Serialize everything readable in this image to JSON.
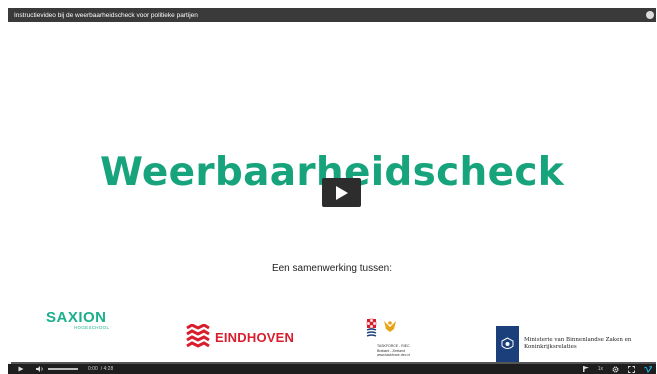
{
  "window": {
    "title": "Instructievideo bij de weerbaarheidscheck voor politieke partijen"
  },
  "slide": {
    "heading": "Weerbaarheidscheck",
    "subtitle": "Een samenwerking tussen:",
    "logos": {
      "saxion": {
        "main": "SAXION",
        "sub": "HOGESCHOOL"
      },
      "eindhoven": {
        "name": "EINDHOVEN"
      },
      "taskforce": {
        "line1": "TASKFORCE - RIEC",
        "line2": "Brabant - Zeeland",
        "line3": "www.taskforce-riec.nl"
      },
      "ministerie": {
        "name": "Ministerie van Binnenlandse Zaken en Koninkrijksrelaties"
      }
    }
  },
  "controls": {
    "current_time": "0:00",
    "duration": "/ 4:28",
    "speed": "1x",
    "progress": 0.004
  },
  "colors": {
    "heading": "#17a37b",
    "saxion": "#1bb08c",
    "eindhoven": "#d81e2c",
    "ministerie": "#1a3f7a",
    "titlebar": "#3a3a3a",
    "controlbar": "#1e1e1e"
  },
  "icons": {
    "play": "play-icon",
    "volume": "volume-icon",
    "chapters": "chapters-icon",
    "settings": "gear-icon",
    "fullscreen": "fullscreen-icon",
    "vimeo": "vimeo-icon"
  }
}
